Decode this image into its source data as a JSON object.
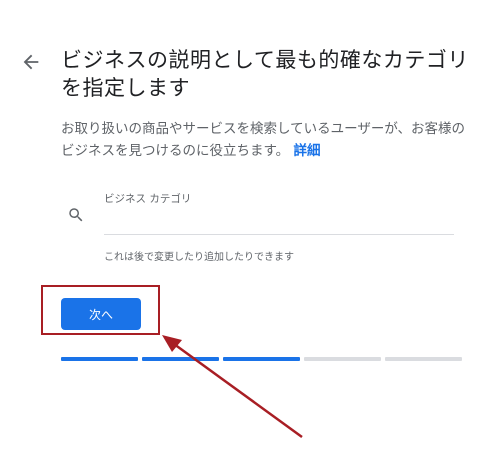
{
  "header": {
    "title": "ビジネスの説明として最も的確なカテゴリを指定します",
    "back_icon": "arrow-left-icon"
  },
  "description": {
    "text": "お取り扱いの商品やサービスを検索しているユーザーが、お客様のビジネスを見つけるのに役立ちます。",
    "link": "詳細"
  },
  "category_field": {
    "label": "ビジネス カテゴリ",
    "value": "",
    "icon": "search-icon",
    "helper": "これは後で変更したり追加したりできます"
  },
  "next_button": {
    "label": "次へ"
  },
  "progress": {
    "total_steps": 5,
    "completed_steps": 3,
    "active_color": "#1a73e8",
    "inactive_color": "#dadce0"
  },
  "annotation": {
    "highlight_color": "#a81e24"
  }
}
